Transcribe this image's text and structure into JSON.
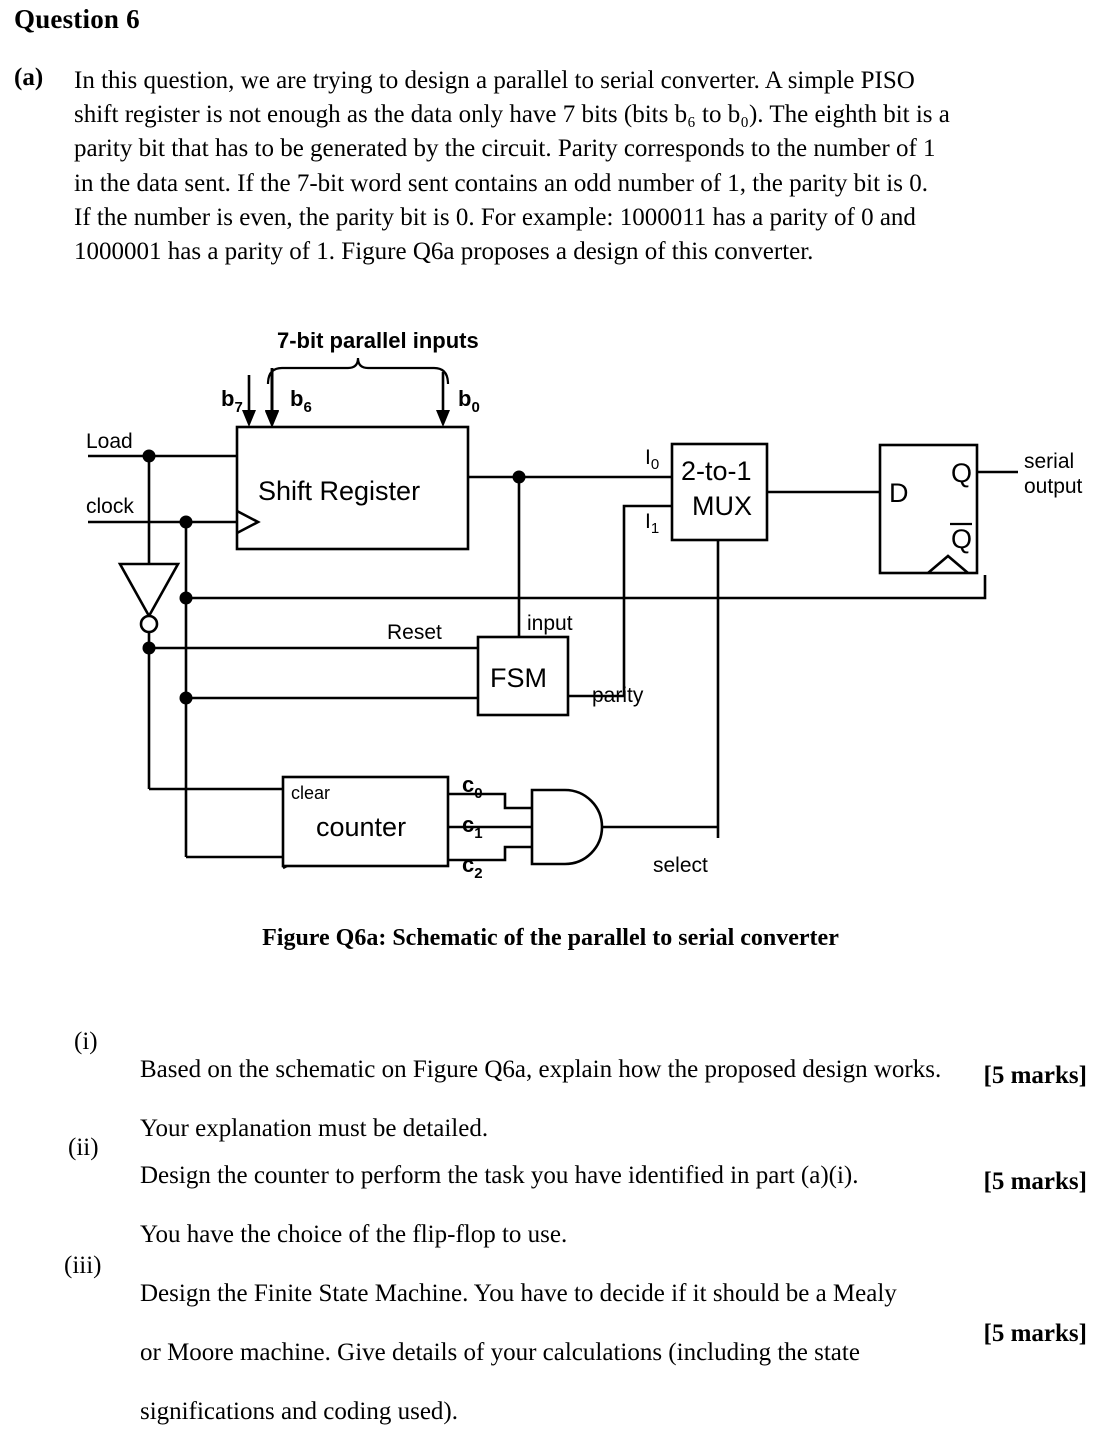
{
  "question": {
    "title": "Question 6",
    "part_a_marker": "(a)",
    "part_a_text": "In this question, we are trying to design a parallel to serial converter.  A simple PISO shift register is not enough as the data only have 7 bits (bits b6 to b0).  The eighth bit is a parity bit that has to be generated by the circuit.  Parity corresponds to the number of 1 in the data sent.  If the 7-bit word sent contains an odd number of 1, the parity bit is 0.  If the number is even, the parity bit is 0.  For example: 1000011 has a parity of 0 and 1000001 has a parity of 1.  Figure Q6a proposes a design of this converter.",
    "lines": [
      "In this question, we are trying to design a parallel to serial converter.  A simple PISO",
      "shift register is not enough as the data only have 7 bits (bits b₆ to b₀).  The eighth bit is a",
      "parity bit that has to be generated by the circuit.  Parity corresponds to the number of 1",
      "in the data sent.  If the 7-bit word sent contains an odd number of 1, the parity bit is 0.",
      "If the number is even, the parity bit is 0.  For example: 1000011 has a parity of 0 and",
      "1000001 has a parity of 1.  Figure Q6a proposes a design of this converter."
    ]
  },
  "figure": {
    "caption": "Figure Q6a:  Schematic of the parallel to serial converter",
    "brace_label": "7-bit parallel inputs",
    "bits": {
      "b7": "b",
      "b7_sub": "7",
      "b6": "b",
      "b6_sub": "6",
      "b0": "b",
      "b0_sub": "0"
    },
    "blocks": {
      "shift_register": "Shift Register",
      "mux_line1": "2-to-1",
      "mux_line2": "MUX",
      "fsm": "FSM",
      "counter": "counter",
      "dff_d": "D",
      "dff_q": "Q",
      "dff_qbar": "Q"
    },
    "signals": {
      "load": "Load",
      "clock": "clock",
      "reset": "Reset",
      "input": "input",
      "parity": "parity",
      "select": "select",
      "clear": "clear",
      "serial_output_line1": "serial",
      "serial_output_line2": "output",
      "i0": "I",
      "i0_sub": "0",
      "i1": "I",
      "i1_sub": "1",
      "c0": "c",
      "c0_sub": "0",
      "c1": "c",
      "c1_sub": "1",
      "c2": "c",
      "c2_sub": "2"
    }
  },
  "subquestions": [
    {
      "marker": "(i)",
      "lines": [
        "Based on the schematic on Figure Q6a, explain how the proposed design works.",
        "Your explanation must be detailed."
      ],
      "marks": "[5 marks]"
    },
    {
      "marker": "(ii)",
      "lines": [
        "Design the counter to perform the task you have identified in part (a)(i).",
        "You have the choice of the flip-flop to use."
      ],
      "marks": "[5 marks]"
    },
    {
      "marker": "(iii)",
      "lines": [
        "Design the Finite State Machine.  You have to decide if it should be a Mealy",
        "or Moore machine.  Give details of your calculations (including the state",
        "significations and coding used)."
      ],
      "marks": "[5 marks]"
    }
  ]
}
